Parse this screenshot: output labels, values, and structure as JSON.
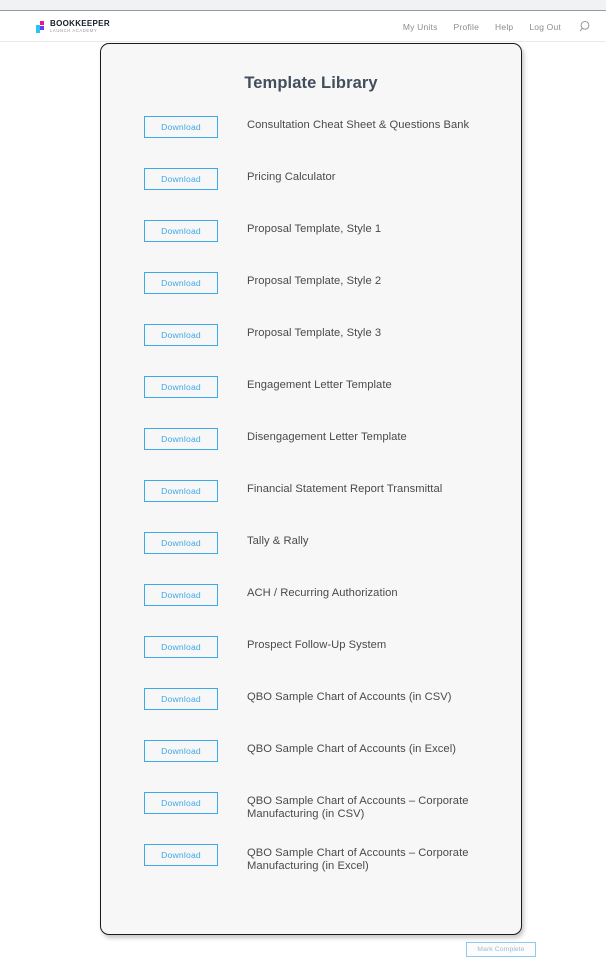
{
  "header": {
    "logo": {
      "name": "BOOKKEEPER",
      "tagline": "LAUNCH ACADEMY",
      "icon": "rocket-logo-icon"
    },
    "nav": [
      {
        "label": "My Units"
      },
      {
        "label": "Profile"
      },
      {
        "label": "Help"
      },
      {
        "label": "Log Out"
      }
    ],
    "search_icon": "search-icon"
  },
  "card": {
    "title": "Template Library",
    "download_label": "Download",
    "items": [
      {
        "title": "Consultation Cheat Sheet & Questions Bank"
      },
      {
        "title": "Pricing Calculator"
      },
      {
        "title": "Proposal Template, Style 1"
      },
      {
        "title": "Proposal Template, Style 2"
      },
      {
        "title": "Proposal Template, Style 3"
      },
      {
        "title": "Engagement Letter Template"
      },
      {
        "title": "Disengagement Letter Template"
      },
      {
        "title": "Financial Statement Report Transmittal"
      },
      {
        "title": "Tally & Rally"
      },
      {
        "title": "ACH / Recurring Authorization"
      },
      {
        "title": "Prospect Follow-Up System"
      },
      {
        "title": "QBO Sample Chart of Accounts (in CSV)"
      },
      {
        "title": "QBO Sample Chart of Accounts (in Excel)"
      },
      {
        "title": "QBO Sample Chart of Accounts – Corporate Manufacturing (in CSV)"
      },
      {
        "title": "QBO Sample Chart of Accounts – Corporate Manufacturing (in Excel)"
      }
    ]
  },
  "footer": {
    "mark_complete_label": "Mark Complete"
  },
  "colors": {
    "accent_blue": "#3da9e8",
    "title_text": "#414e5e",
    "body_text": "#4a4a4a",
    "card_bg": "#f7f7f7",
    "card_border": "#1b1b1b",
    "nav_text": "#8d8d8d",
    "mark_complete_border": "#8fc9ee"
  }
}
